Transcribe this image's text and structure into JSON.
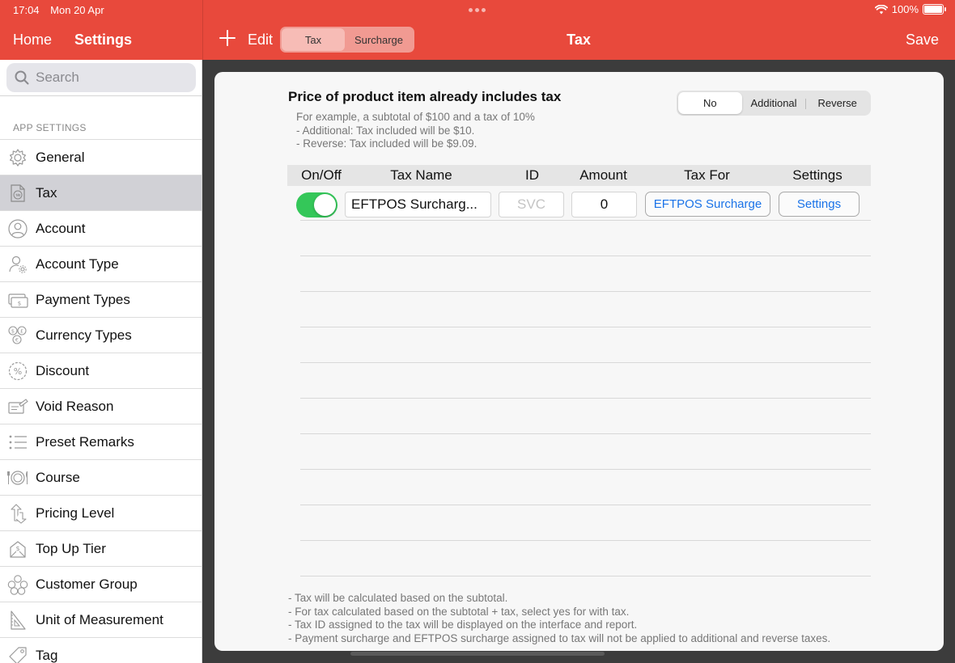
{
  "status_bar": {
    "time": "17:04",
    "date": "Mon 20 Apr",
    "battery": "100%",
    "battery_level": 1.0
  },
  "nav": {
    "home": "Home",
    "settings": "Settings",
    "edit": "Edit",
    "segments": [
      {
        "label": "Tax",
        "selected": true
      },
      {
        "label": "Surcharge",
        "selected": false
      }
    ],
    "title": "Tax",
    "save": "Save"
  },
  "sidebar": {
    "search_placeholder": "Search",
    "section_label": "APP SETTINGS",
    "items": [
      {
        "label": "General",
        "icon": "gear-icon",
        "active": false
      },
      {
        "label": "Tax",
        "icon": "tax-document-icon",
        "active": true
      },
      {
        "label": "Account",
        "icon": "person-icon",
        "active": false
      },
      {
        "label": "Account Type",
        "icon": "person-gear-icon",
        "active": false
      },
      {
        "label": "Payment Types",
        "icon": "cash-icon",
        "active": false
      },
      {
        "label": "Currency Types",
        "icon": "currency-coins-icon",
        "active": false
      },
      {
        "label": "Discount",
        "icon": "percent-badge-icon",
        "active": false
      },
      {
        "label": "Void Reason",
        "icon": "void-card-icon",
        "active": false
      },
      {
        "label": "Preset Remarks",
        "icon": "list-icon",
        "active": false
      },
      {
        "label": "Course",
        "icon": "plate-cutlery-icon",
        "active": false
      },
      {
        "label": "Pricing Level",
        "icon": "up-down-arrows-icon",
        "active": false
      },
      {
        "label": "Top Up Tier",
        "icon": "dollar-envelope-icon",
        "active": false
      },
      {
        "label": "Customer Group",
        "icon": "group-icon",
        "active": false
      },
      {
        "label": "Unit of Measurement",
        "icon": "ruler-triangle-icon",
        "active": false
      },
      {
        "label": "Tag",
        "icon": "tag-icon",
        "active": false
      }
    ]
  },
  "panel": {
    "title": "Price of product item already includes tax",
    "desc": [
      "For example, a subtotal of $100 and a tax of 10%",
      "- Additional: Tax included will be $10.",
      "- Reverse: Tax included will be $9.09."
    ],
    "options": [
      {
        "label": "No",
        "selected": true
      },
      {
        "label": "Additional",
        "selected": false
      },
      {
        "label": "Reverse",
        "selected": false
      }
    ],
    "columns": [
      "On/Off",
      "Tax Name",
      "ID",
      "Amount",
      "Tax For",
      "Settings"
    ],
    "rows": [
      {
        "on": true,
        "name": "EFTPOS Surcharg...",
        "id_placeholder": "SVC",
        "amount": "0",
        "tax_for": "EFTPOS Surcharge",
        "settings": "Settings"
      }
    ],
    "notes": [
      "- Tax will be calculated based on the subtotal.",
      "- For tax calculated based on the subtotal + tax, select yes for with tax.",
      "- Tax ID assigned to the tax will be displayed on the interface and report.",
      "- Payment surcharge and EFTPOS surcharge assigned to tax will not be applied to additional and reverse taxes."
    ]
  },
  "colors": {
    "brand_red": "#e8493c",
    "toggle_on": "#34c759",
    "link_blue": "#1a73e8"
  }
}
